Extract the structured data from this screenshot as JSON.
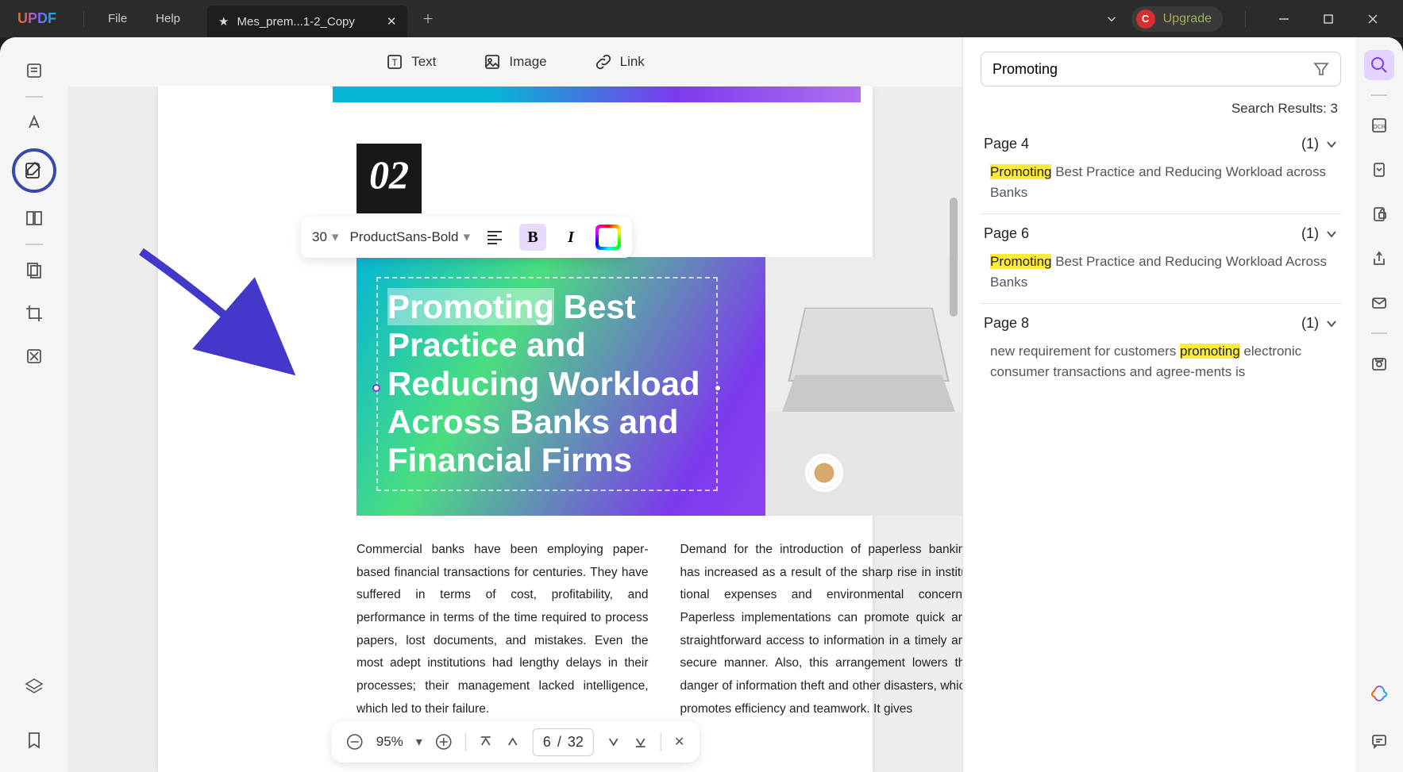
{
  "titlebar": {
    "logo": "UPDF",
    "menus": [
      "File",
      "Help"
    ],
    "tab": {
      "prefix_icon": "★",
      "title": "Mes_prem...1-2_Copy"
    },
    "upgrade": {
      "avatar_letter": "C",
      "label": "Upgrade"
    }
  },
  "ribbon": {
    "text": "Text",
    "image": "Image",
    "link": "Link"
  },
  "edit_toolbar": {
    "font_size": "30",
    "font_name": "ProductSans-Bold"
  },
  "document": {
    "chapter_badge": "02",
    "hero_highlight": "Promoting",
    "hero_rest": " Best Practice and Reducing Workload Across Banks and Financial Firms",
    "col1": "Commercial banks have been employing paper-based financial transactions for centuries. They have suffered in terms of cost, profitability, and performance in terms of the time required to process papers, lost documents, and mistakes. Even the most adept institutions had lengthy delays in their processes; their management lacked intelligence, which led to their failure.",
    "col2": "Demand for the introduction of paperless banking has increased as a result of the sharp rise in institu-tional expenses and environmental concerns. Paperless implementations can promote quick and straightforward access to information in a timely and secure manner. Also, this arrangement lowers the danger of information theft and other disasters, which promotes efficiency and teamwork. It gives"
  },
  "pagenav": {
    "zoom": "95%",
    "page_current": "6",
    "page_sep": "/",
    "page_total": "32"
  },
  "search": {
    "query": "Promoting",
    "results_label": "Search Results: 3",
    "groups": [
      {
        "page": "Page 4",
        "count": "(1)",
        "hl": "Promoting",
        "rest": " Best Practice and Reducing Workload across Banks"
      },
      {
        "page": "Page 6",
        "count": "(1)",
        "hl": "Promoting",
        "rest": " Best Practice and Reducing Workload Across Banks"
      },
      {
        "page": "Page 8",
        "count": "(1)",
        "pre": "new requirement for customers ",
        "hl": "promoting",
        "rest": " electronic consumer transactions and agree-ments is"
      }
    ]
  }
}
